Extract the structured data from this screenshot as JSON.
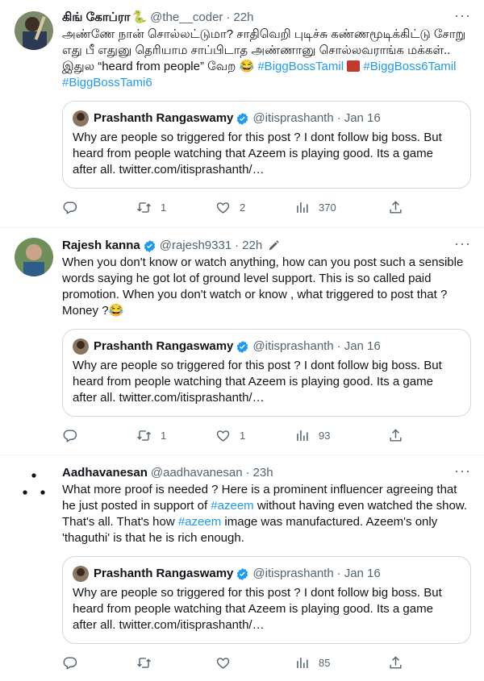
{
  "tweets": [
    {
      "name": "கிங் கோப்ரா",
      "name_emoji": "🐍",
      "handle": "@the__coder",
      "time": "22h",
      "text_main": "அண்ணே நான் சொல்லட்டுமா? சாதிவெறி புடிச்சு கண்ணமூடிக்கிட்டு சோறு எது பீ எதுனு தெரியாம சாப்பிடாத அண்ணானு சொல்லவராங்க மக்கள்.. இதுல “heard from people” வேற 😂 ",
      "hashtags": [
        "#BiggBossTamil",
        "#BiggBoss6Tamil",
        "#BiggBossTami6"
      ],
      "quote": {
        "name": "Prashanth Rangaswamy",
        "handle": "@itisprashanth",
        "time": "Jan 16",
        "text": "Why are people so triggered for this post ? I dont follow big boss. But heard from people watching that Azeem is playing good. Its a game after all. twitter.com/itisprashanth/…"
      },
      "replies": "",
      "retweets": "1",
      "likes": "2",
      "views": "370"
    },
    {
      "name": "Rajesh kanna",
      "handle": "@rajesh9331",
      "time": "22h",
      "text": "When you don't know or watch anything, how can you post such a sensible words saying he got lot of ground level support. This is so called paid promotion. When you don't watch or know , what triggered to post that ? Money ?😂",
      "quote": {
        "name": "Prashanth Rangaswamy",
        "handle": "@itisprashanth",
        "time": "Jan 16",
        "text": "Why are people so triggered for this post ? I dont follow big boss. But heard from people watching that Azeem is playing good. Its a game after all. twitter.com/itisprashanth/…"
      },
      "replies": "",
      "retweets": "1",
      "likes": "1",
      "views": "93"
    },
    {
      "name": "Aadhavanesan",
      "handle": "@aadhavanesan",
      "time": "23h",
      "text_a": "What more proof is needed ? Here is a prominent influencer agreeing that he just posted in support of ",
      "tag_a": "#azeem",
      "text_b": " without having even watched the show. That's all. That's how ",
      "tag_b": "#azeem",
      "text_c": " image was manufactured. Azeem's only 'thaguthi' is that he is rich enough.",
      "quote": {
        "name": "Prashanth Rangaswamy",
        "handle": "@itisprashanth",
        "time": "Jan 16",
        "text": "Why are people so triggered for this post ? I dont follow big boss. But heard from people watching that Azeem is playing good. Its a game after all. twitter.com/itisprashanth/…"
      },
      "replies": "",
      "retweets": "",
      "likes": "",
      "views": "85"
    }
  ],
  "common": {
    "separator": "·",
    "more": "···"
  },
  "colors": {
    "link": "#1d9bf0",
    "muted": "#536471",
    "verified": "#1d9bf0"
  }
}
